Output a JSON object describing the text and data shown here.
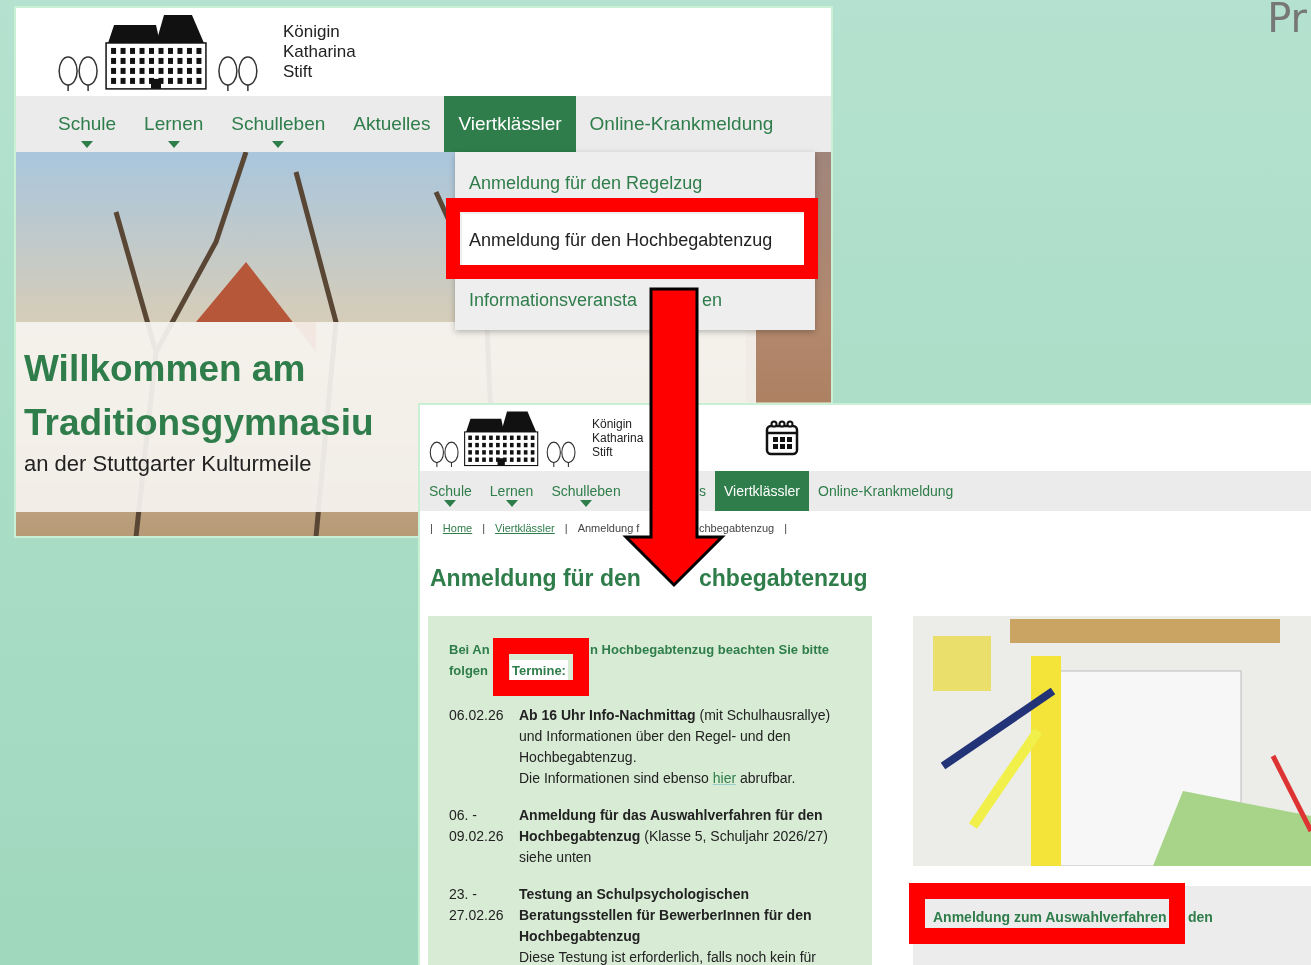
{
  "slide_title": "Pr",
  "site_home": {
    "brand": [
      "Königin",
      "Katharina",
      "Stift"
    ],
    "nav": [
      {
        "label": "Schule",
        "has_submenu": true,
        "selected": false
      },
      {
        "label": "Lernen",
        "has_submenu": true,
        "selected": false
      },
      {
        "label": "Schulleben",
        "has_submenu": true,
        "selected": false
      },
      {
        "label": "Aktuelles",
        "has_submenu": false,
        "selected": false
      },
      {
        "label": "Viertklässler",
        "has_submenu": false,
        "selected": true
      },
      {
        "label": "Online-Krankmeldung",
        "has_submenu": false,
        "selected": false
      }
    ],
    "dropdown": [
      {
        "parts": [
          "Anmeldung für den Regelzug"
        ],
        "selected": false
      },
      {
        "parts": [
          "Anmeldung für den Hochbegabtenzug"
        ],
        "selected": true
      },
      {
        "parts": [
          "Informationsveransta",
          "en"
        ],
        "selected": false
      }
    ],
    "hero_title": [
      "Willkommen am",
      "Traditionsgymnasiu"
    ],
    "hero_subtitle": "an der Stuttgarter Kulturmeile"
  },
  "site_page": {
    "brand": [
      "Königin",
      "Katharina",
      "Stift"
    ],
    "nav": [
      {
        "label": "Schule",
        "has_submenu": true,
        "selected": false
      },
      {
        "label": "Lernen",
        "has_submenu": true,
        "selected": false
      },
      {
        "label": "Schulleben",
        "has_submenu": true,
        "selected": false
      },
      {
        "label": "s",
        "has_submenu": false,
        "selected": false
      },
      {
        "label": "Viertklässler",
        "has_submenu": false,
        "selected": true
      },
      {
        "label": "Online-Krankmeldung",
        "has_submenu": false,
        "selected": false
      }
    ],
    "breadcrumb": {
      "separator": "|",
      "items": [
        {
          "parts": [
            "Home"
          ],
          "link": true
        },
        {
          "parts": [
            "Viertklässler"
          ],
          "link": true
        },
        {
          "parts": [
            "Anmeldung f",
            "chbegabtenzug"
          ],
          "link": false
        }
      ]
    },
    "title_parts": [
      "Anmeldung für den",
      "chbegabtenzug"
    ],
    "intro_lines": [
      [
        "Bei An",
        "n Hochbegabtenzug beachten Sie bitte"
      ],
      [
        "folgen"
      ]
    ],
    "intro_highlight": "Termine:",
    "dates": [
      {
        "date": [
          "06.02.26"
        ],
        "text": "**Ab 16 Uhr Info-Nachmittag** (mit Schulhausrallye) und Informationen über den Regel- und den Hochbegabtenzug.",
        "note": "Die Informationen sind ebenso",
        "link": "hier",
        "note_end": "abrufbar."
      },
      {
        "date": [
          "06. -",
          "09.02.26"
        ],
        "text": "**Anmeldung für das Auswahlverfahren für den Hochbegabtenzug** (Klasse 5, Schuljahr 2026/27)",
        "note": "siehe unten"
      },
      {
        "date": [
          "23. -",
          "27.02.26"
        ],
        "text": "**Testung an Schulpsychologischen Beratungsstellen für BewerberInnen für den Hochbegabtenzug**",
        "note": "Diese Testung ist erforderlich, falls noch kein für"
      }
    ],
    "side_link_parts": [
      "Anmeldung zum Auswahlverfahren",
      "den"
    ]
  }
}
